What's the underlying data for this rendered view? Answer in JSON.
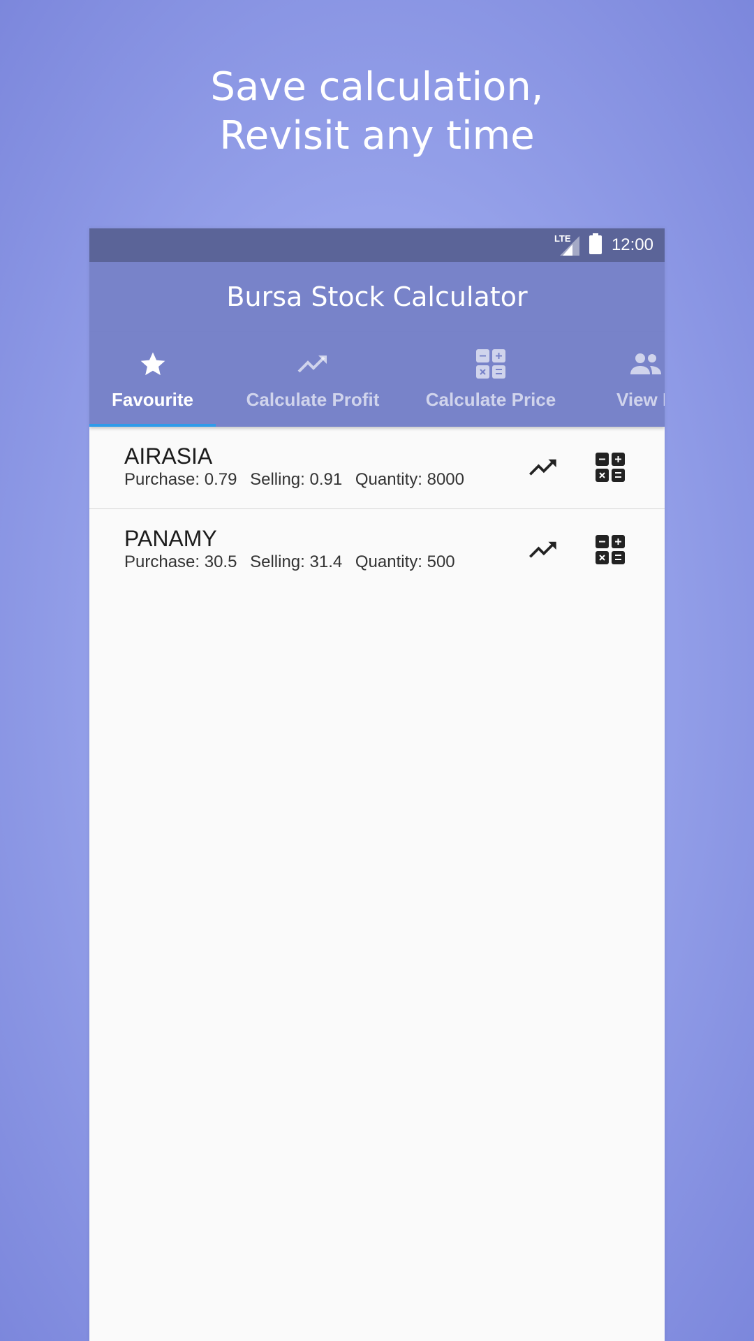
{
  "promo": {
    "line1": "Save calculation,",
    "line2": "Revisit any time"
  },
  "status": {
    "network": "LTE",
    "time": "12:00"
  },
  "appbar": {
    "title": "Bursa Stock Calculator"
  },
  "tabs": [
    {
      "label": "Favourite",
      "icon": "star-icon",
      "active": true
    },
    {
      "label": "Calculate Profit",
      "icon": "trending-up-icon",
      "active": false
    },
    {
      "label": "Calculate Price",
      "icon": "calculator-icon",
      "active": false
    },
    {
      "label": "View Br",
      "icon": "people-icon",
      "active": false
    }
  ],
  "favourites": [
    {
      "name": "AIRASIA",
      "purchase": "Purchase: 0.79",
      "selling": "Selling: 0.91",
      "quantity": "Quantity: 8000"
    },
    {
      "name": "PANAMY",
      "purchase": "Purchase: 30.5",
      "selling": "Selling: 31.4",
      "quantity": "Quantity: 500"
    }
  ],
  "colors": {
    "statusbar": "#5b6498",
    "appbar": "#7883c9",
    "indicator": "#2f9be9",
    "list_bg": "#fafafa"
  }
}
